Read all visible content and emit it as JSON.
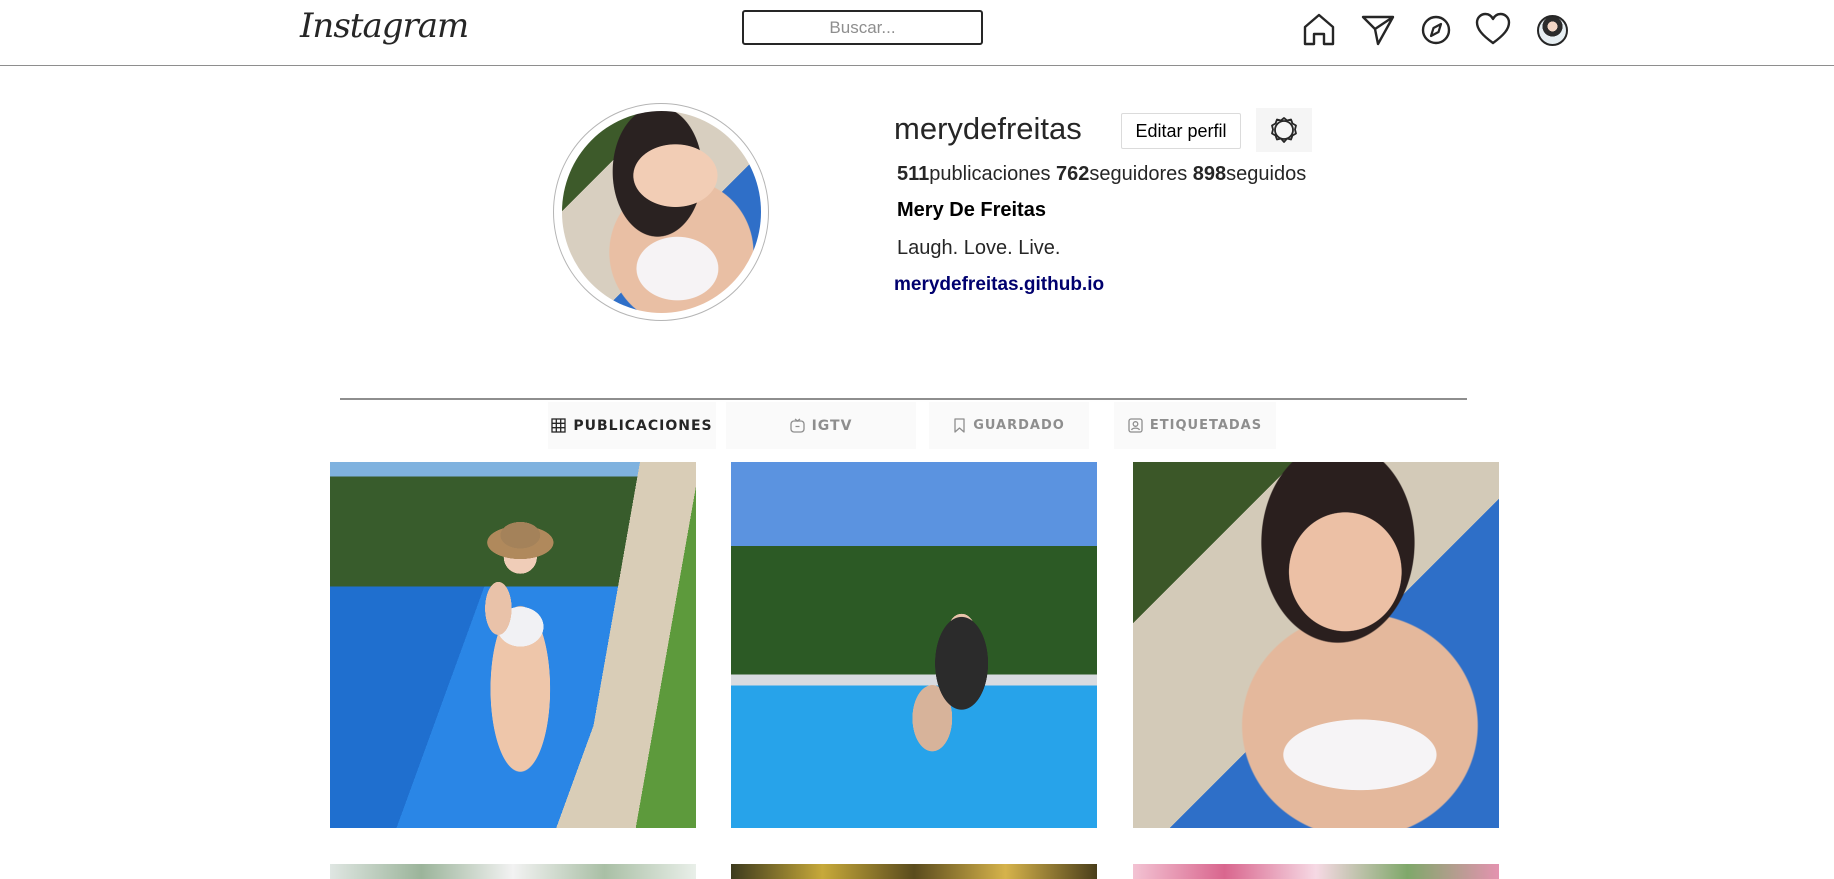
{
  "header": {
    "logo": "Instagram",
    "search_placeholder": "Buscar...",
    "icons": [
      "home-icon",
      "direct-message-icon",
      "explore-compass-icon",
      "activity-heart-icon",
      "profile-avatar"
    ]
  },
  "profile": {
    "username": "merydefreitas",
    "edit_label": "Editar perfil",
    "settings_icon": "gear-icon",
    "stats": {
      "posts_count": "511",
      "posts_label": "publicaciones",
      "followers_count": "762",
      "followers_label": "seguidores",
      "following_count": "898",
      "following_label": "seguidos"
    },
    "full_name": "Mery De Freitas",
    "bio": "Laugh. Love. Live.",
    "website": "merydefreitas.github.io"
  },
  "tabs": [
    {
      "label": "PUBLICACIONES",
      "icon": "grid-icon",
      "active": true
    },
    {
      "label": "IGTV",
      "icon": "igtv-icon",
      "active": false
    },
    {
      "label": "GUARDADO",
      "icon": "bookmark-icon",
      "active": false
    },
    {
      "label": "ETIQUETADAS",
      "icon": "tagged-user-icon",
      "active": false
    }
  ],
  "colors": {
    "text": "#262626",
    "muted": "#8e8e8e",
    "link": "#00006e",
    "border": "#dbdbdb"
  }
}
